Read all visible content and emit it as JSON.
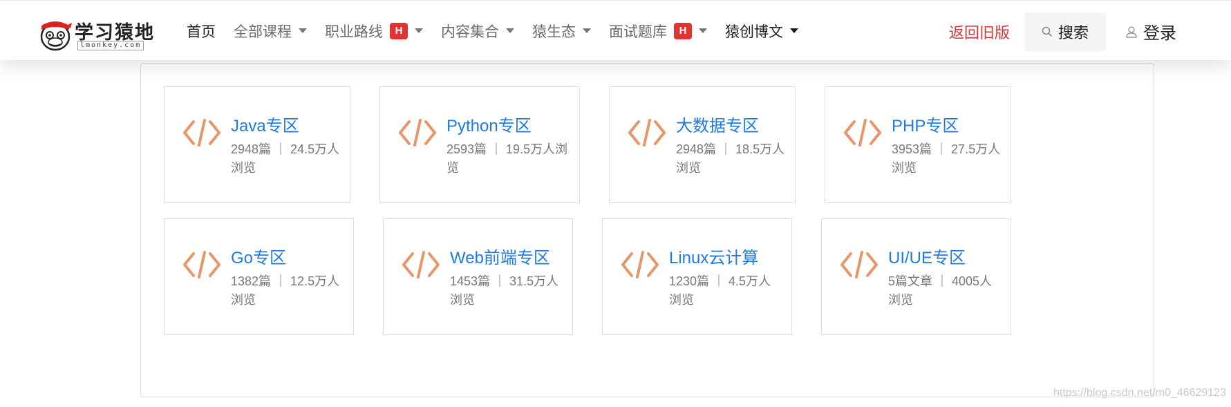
{
  "header": {
    "logo": {
      "title": "学习猿地",
      "subtitle": "lmonkey.com",
      "icon": "monkey-face-icon"
    },
    "nav": [
      {
        "label": "首页",
        "caret": false,
        "badge": "",
        "dark": true
      },
      {
        "label": "全部课程",
        "caret": true,
        "badge": "",
        "dark": false
      },
      {
        "label": "职业路线",
        "caret": true,
        "badge": "H",
        "dark": false
      },
      {
        "label": "内容集合",
        "caret": true,
        "badge": "",
        "dark": false
      },
      {
        "label": "猿生态",
        "caret": true,
        "badge": "",
        "dark": false
      },
      {
        "label": "面试题库",
        "caret": true,
        "badge": "H",
        "dark": false
      },
      {
        "label": "猿创博文",
        "caret": true,
        "badge": "",
        "dark": true
      }
    ],
    "back_old_label": "返回旧版",
    "search_label": "搜索",
    "login_label": "登录"
  },
  "colors": {
    "accent_blue": "#1e7be0",
    "badge_red": "#e03333",
    "back_red": "#d9363a",
    "icon_orange": "#e8956a"
  },
  "cards": [
    {
      "title": "Java专区",
      "stats": "2948篇 ｜ 24.5万人浏览",
      "icon": "code-icon"
    },
    {
      "title": "Python专区",
      "stats": "2593篇 ｜ 19.5万人浏览",
      "icon": "code-icon"
    },
    {
      "title": "大数据专区",
      "stats": "2948篇 ｜ 18.5万人浏览",
      "icon": "code-icon"
    },
    {
      "title": "PHP专区",
      "stats": "3953篇 ｜ 27.5万人浏览",
      "icon": "code-icon"
    },
    {
      "title": "Go专区",
      "stats": "1382篇 ｜ 12.5万人浏览",
      "icon": "code-icon"
    },
    {
      "title": "Web前端专区",
      "stats": "1453篇 ｜ 31.5万人浏览",
      "icon": "code-icon"
    },
    {
      "title": "Linux云计算",
      "stats": "1230篇 ｜ 4.5万人浏览",
      "icon": "code-icon"
    },
    {
      "title": "UI/UE专区",
      "stats": "5篇文章 ｜ 4005人浏览",
      "icon": "code-icon"
    }
  ],
  "watermark": "https://blog.csdn.net/m0_46629123"
}
